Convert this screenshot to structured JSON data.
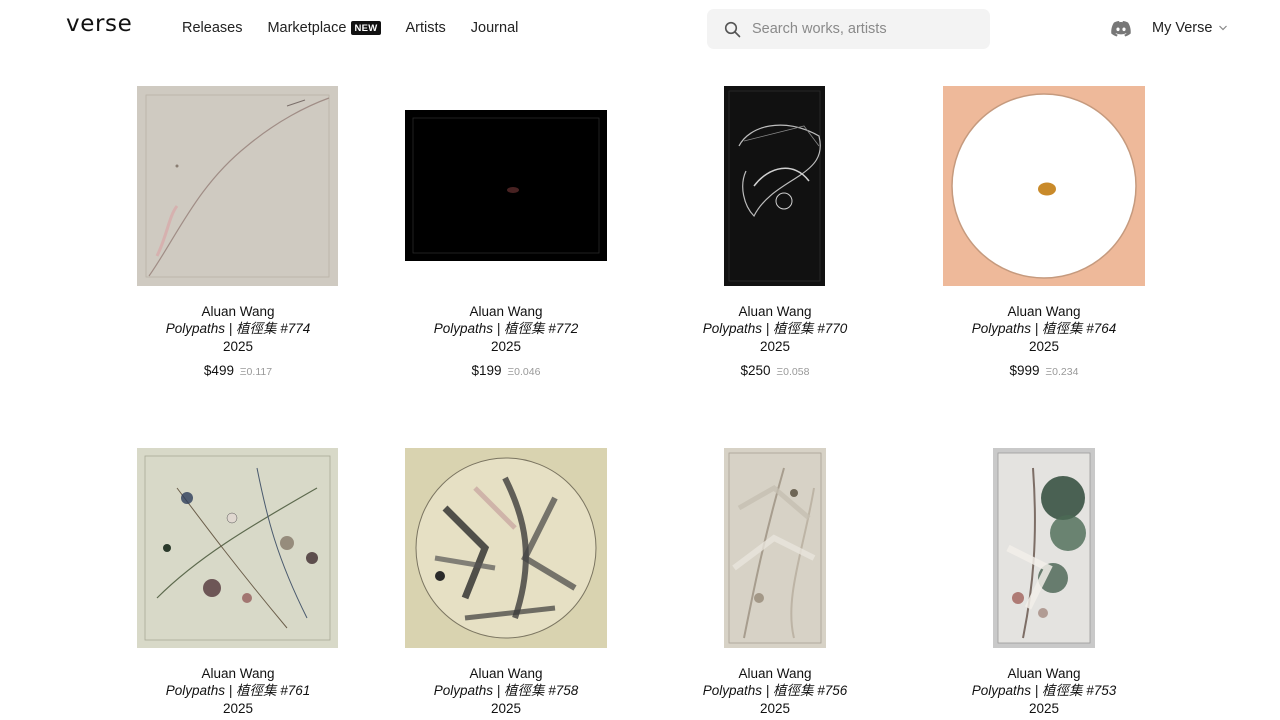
{
  "header": {
    "logo": "verse",
    "nav": [
      {
        "label": "Releases"
      },
      {
        "label": "Marketplace",
        "badge": "NEW"
      },
      {
        "label": "Artists"
      },
      {
        "label": "Journal"
      }
    ],
    "search_placeholder": "Search works, artists",
    "account_label": "My Verse"
  },
  "icons": {
    "search": "search-icon",
    "discord": "discord-icon",
    "chevron": "chevron-down-icon"
  },
  "works": [
    {
      "artist": "Aluan Wang",
      "title": "Polypaths | 植徑集 #774",
      "year": "2025",
      "price": "$499",
      "eth": "Ξ0.117",
      "bg": "#cfcac1"
    },
    {
      "artist": "Aluan Wang",
      "title": "Polypaths | 植徑集 #772",
      "year": "2025",
      "price": "$199",
      "eth": "Ξ0.046",
      "bg": "#000000"
    },
    {
      "artist": "Aluan Wang",
      "title": "Polypaths | 植徑集 #770",
      "year": "2025",
      "price": "$250",
      "eth": "Ξ0.058",
      "bg": "#111111"
    },
    {
      "artist": "Aluan Wang",
      "title": "Polypaths | 植徑集 #764",
      "year": "2025",
      "price": "$999",
      "eth": "Ξ0.234",
      "bg": "#eeb99a"
    },
    {
      "artist": "Aluan Wang",
      "title": "Polypaths | 植徑集 #761",
      "year": "2025",
      "bg": "#d8d9c8"
    },
    {
      "artist": "Aluan Wang",
      "title": "Polypaths | 植徑集 #758",
      "year": "2025",
      "bg": "#d9d3b0"
    },
    {
      "artist": "Aluan Wang",
      "title": "Polypaths | 植徑集 #756",
      "year": "2025",
      "bg": "#d7d2c6"
    },
    {
      "artist": "Aluan Wang",
      "title": "Polypaths | 植徑集 #753",
      "year": "2025",
      "bg": "#c9c9c9"
    }
  ]
}
